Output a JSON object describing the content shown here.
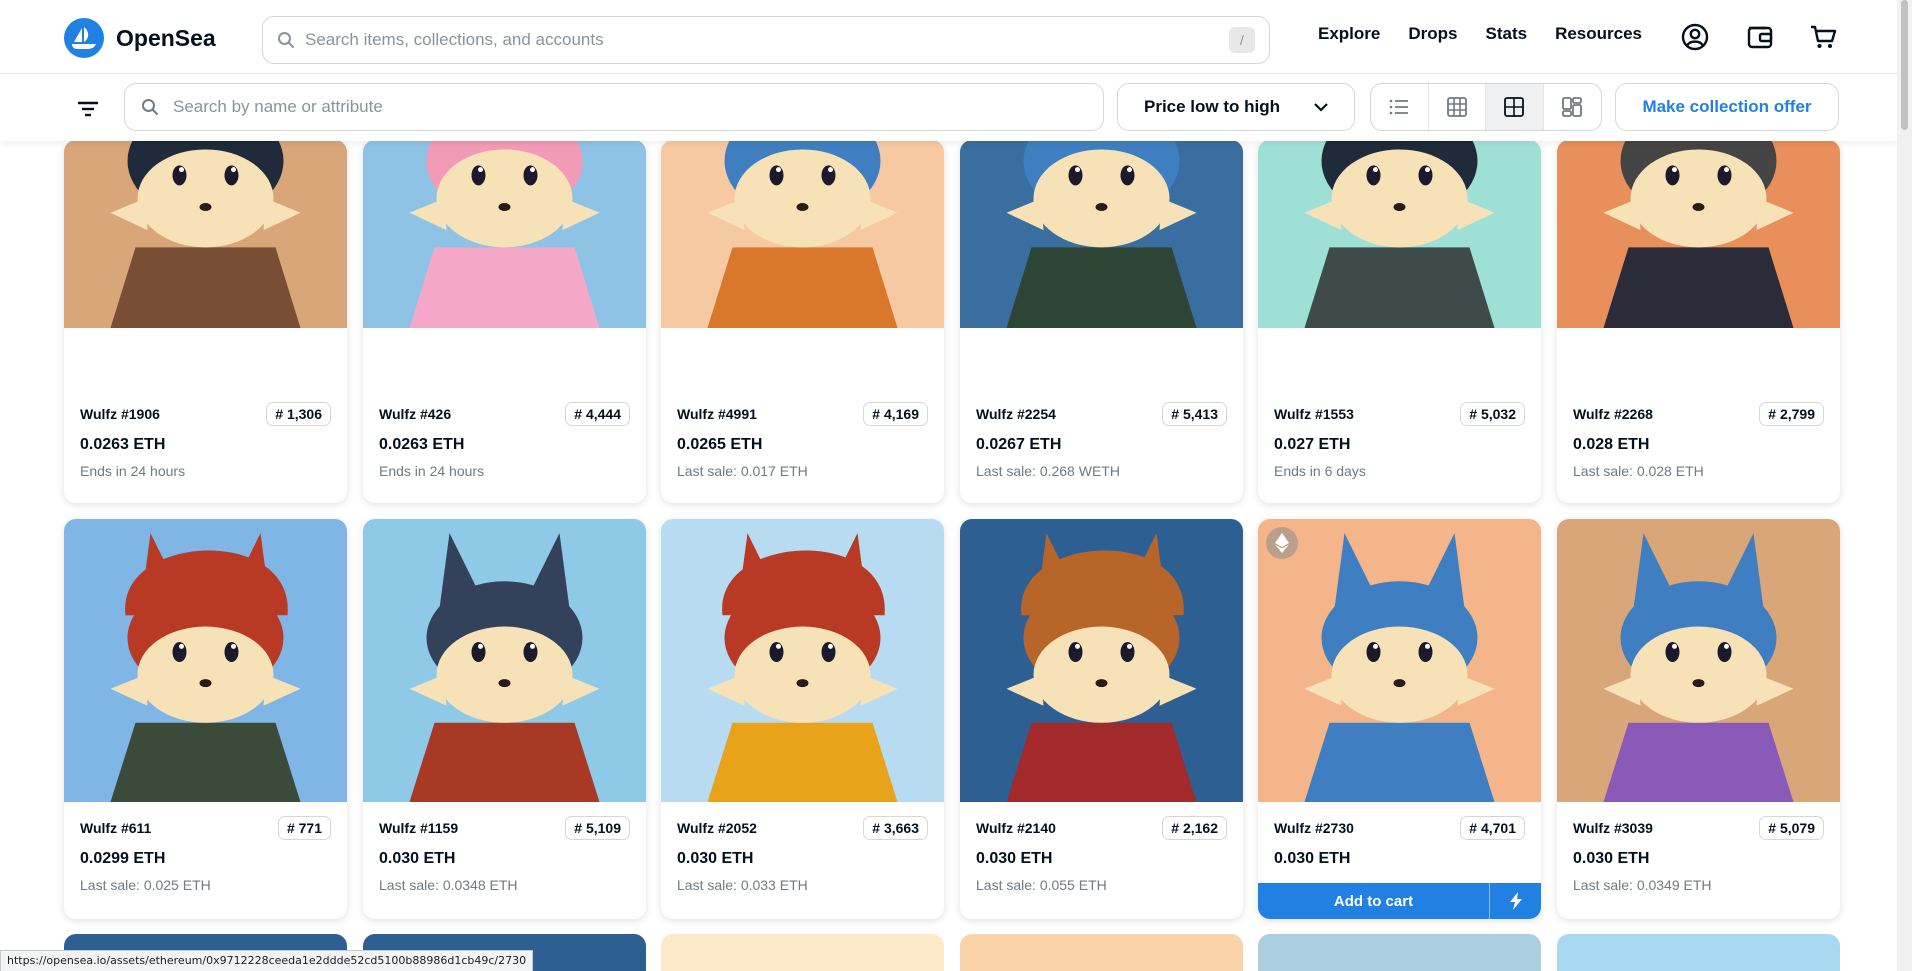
{
  "colors": {
    "accent": "#2081e2",
    "text": "#04111d",
    "muted": "#707a83",
    "border": "#d7d7d7"
  },
  "brand": {
    "name": "OpenSea",
    "logo_icon": "opensea-sailboat-icon"
  },
  "global_search": {
    "placeholder": "Search items, collections, and accounts",
    "shortcut": "/"
  },
  "nav": {
    "links": [
      "Explore",
      "Drops",
      "Stats",
      "Resources"
    ],
    "icons": [
      "account-icon",
      "wallet-icon",
      "cart-icon"
    ]
  },
  "toolbar": {
    "filter_icon": "filter-icon",
    "search_placeholder": "Search by name or attribute",
    "sort_value": "Price low to high",
    "view_modes": [
      "list-view-icon",
      "small-grid-icon",
      "large-grid-icon",
      "masonry-view-icon"
    ],
    "active_view_mode": "large-grid-icon",
    "offer_label": "Make collection offer"
  },
  "items": [
    {
      "name": "Wulfz #1906",
      "rank": "# 1,306",
      "price": "0.0263 ETH",
      "sub": "Ends in 24 hours",
      "art": {
        "bg": "#d9a679",
        "fur": "#f7e2b8",
        "ears": "#1f2b3a",
        "hair": "#1f2b3a",
        "clothes": "#7a4e35"
      }
    },
    {
      "name": "Wulfz #426",
      "rank": "# 4,444",
      "price": "0.0263 ETH",
      "sub": "Ends in 24 hours",
      "art": {
        "bg": "#8fc3e6",
        "fur": "#f7e2b8",
        "ears": "#f29bb6",
        "hair": "",
        "clothes": "#f4a7c6"
      }
    },
    {
      "name": "Wulfz #4991",
      "rank": "# 4,169",
      "price": "0.0265 ETH",
      "sub": "Last sale: 0.017 ETH",
      "art": {
        "bg": "#f6c9a2",
        "fur": "#f7e2b8",
        "ears": "#3f7fc1",
        "hair": "",
        "clothes": "#d9772a"
      }
    },
    {
      "name": "Wulfz #2254",
      "rank": "# 5,413",
      "price": "0.0267 ETH",
      "sub": "Last sale: 0.268 WETH",
      "art": {
        "bg": "#3a6ea0",
        "fur": "#f7e2b8",
        "ears": "#3f7fc1",
        "hair": "",
        "clothes": "#2e4536"
      }
    },
    {
      "name": "Wulfz #1553",
      "rank": "# 5,032",
      "price": "0.027 ETH",
      "sub": "Ends in 6 days",
      "art": {
        "bg": "#9fe0d6",
        "fur": "#f7e2b8",
        "ears": "#1f2b3a",
        "hair": "",
        "clothes": "#3f4a4a"
      }
    },
    {
      "name": "Wulfz #2268",
      "rank": "# 2,799",
      "price": "0.028 ETH",
      "sub": "Last sale: 0.028 ETH",
      "art": {
        "bg": "#e98f5b",
        "fur": "#f7e2b8",
        "ears": "#444444",
        "hair": "#444444",
        "clothes": "#2b2b3a"
      }
    },
    {
      "name": "Wulfz #611",
      "rank": "# 771",
      "price": "0.0299 ETH",
      "sub": "Last sale: 0.025 ETH",
      "art": {
        "bg": "#7fb6e6",
        "fur": "#f7e2b8",
        "ears": "#b83a24",
        "hair": "#b83a24",
        "clothes": "#3c4a3a"
      }
    },
    {
      "name": "Wulfz #1159",
      "rank": "# 5,109",
      "price": "0.030 ETH",
      "sub": "Last sale: 0.0348 ETH",
      "art": {
        "bg": "#8ec9e8",
        "fur": "#f7e2b8",
        "ears": "#34415a",
        "hair": "",
        "clothes": "#a83a25"
      }
    },
    {
      "name": "Wulfz #2052",
      "rank": "# 3,663",
      "price": "0.030 ETH",
      "sub": "Last sale: 0.033 ETH",
      "art": {
        "bg": "#b7dcf2",
        "fur": "#f7e2b8",
        "ears": "#b83a24",
        "hair": "#b83a24",
        "clothes": "#e9a31b"
      }
    },
    {
      "name": "Wulfz #2140",
      "rank": "# 2,162",
      "price": "0.030 ETH",
      "sub": "Last sale: 0.055 ETH",
      "art": {
        "bg": "#2e5f92",
        "fur": "#f7e2b8",
        "ears": "#b8652a",
        "hair": "#b8652a",
        "clothes": "#a32a2a"
      }
    },
    {
      "name": "Wulfz #2730",
      "rank": "# 4,701",
      "price": "0.030 ETH",
      "sub": "",
      "cart_label": "Add to cart",
      "art": {
        "bg": "#f4b58a",
        "fur": "#f7e2b8",
        "ears": "#3f7fc1",
        "hair": "",
        "clothes": "#3f7fc1"
      }
    },
    {
      "name": "Wulfz #3039",
      "rank": "# 5,079",
      "price": "0.030 ETH",
      "sub": "Last sale: 0.0349 ETH",
      "art": {
        "bg": "#d9a679",
        "fur": "#f7e2b8",
        "ears": "#3f7fc1",
        "hair": "",
        "clothes": "#8a5ab8"
      }
    }
  ],
  "partial_row_colors": [
    "#2e5f92",
    "#2e5f92",
    "#fde9c8",
    "#fbd3a8",
    "#a9cfe0",
    "#a9d9f0"
  ],
  "status_url": "https://opensea.io/assets/ethereum/0x9712228ceeda1e2ddde52cd5100b88986d1cb49c/2730"
}
